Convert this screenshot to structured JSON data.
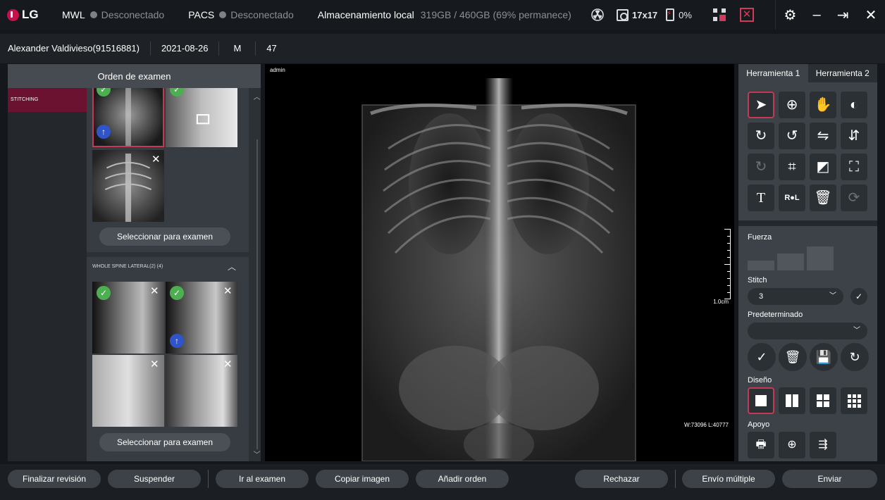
{
  "topbar": {
    "logo_text": "LG",
    "mwl": {
      "label": "MWL",
      "state": "Desconectado"
    },
    "pacs": {
      "label": "PACS",
      "state": "Desconectado"
    },
    "storage": {
      "label": "Almacenamiento local",
      "value": "319GB / 460GB (69% permanece)"
    },
    "detector_size": "17x17",
    "battery": "0%",
    "icons": [
      "radiation-icon",
      "detector-icon",
      "battery-icon",
      "qr-icon",
      "close-box-icon",
      "gear-icon",
      "minimize-icon",
      "logout-icon",
      "close-icon"
    ]
  },
  "patient": {
    "name": "Alexander Valdivieso(91516881)",
    "date": "2021-08-26",
    "sex": "M",
    "age": "47"
  },
  "left_panel": {
    "title": "Orden de examen",
    "orders": [
      {
        "label": "STITCHING"
      }
    ],
    "group2_title": "WHOLE SPINE LATERAL(2) (4)",
    "select_button": "Seleccionar para examen",
    "colors": {
      "selected": "#c43a55",
      "ok": "#4caf50",
      "upload": "#2f55c8"
    }
  },
  "viewer": {
    "user_label": "admin",
    "scale_label": "1.0cm",
    "window_level": "W:73096 L:40777"
  },
  "right_panel": {
    "tabs": [
      "Herramienta 1",
      "Herramienta 2"
    ],
    "tools": [
      {
        "name": "pointer-icon",
        "glyph": "➤"
      },
      {
        "name": "zoom-icon",
        "glyph": "⊕"
      },
      {
        "name": "pan-hand-icon",
        "glyph": "✋"
      },
      {
        "name": "window-level-icon",
        "glyph": "◐"
      },
      {
        "name": "rotate-cw-icon",
        "glyph": "↻"
      },
      {
        "name": "rotate-ccw-icon",
        "glyph": "↺"
      },
      {
        "name": "flip-horizontal-icon",
        "glyph": "⇋"
      },
      {
        "name": "flip-vertical-icon",
        "glyph": "⇵"
      },
      {
        "name": "rotate-360-icon",
        "glyph": "↻"
      },
      {
        "name": "crop-icon",
        "glyph": "⌗"
      },
      {
        "name": "invert-icon",
        "glyph": "◩"
      },
      {
        "name": "fit-screen-icon",
        "glyph": "⛶"
      },
      {
        "name": "text-icon",
        "glyph": "T"
      },
      {
        "name": "marker-rl-icon",
        "glyph": "R●L"
      },
      {
        "name": "trash-icon",
        "glyph": "🗑"
      },
      {
        "name": "reset-icon",
        "glyph": "⟳"
      }
    ],
    "fuerza_label": "Fuerza",
    "stitch_label": "Stitch",
    "stitch_value": "3",
    "preset_label": "Predeterminado",
    "preset_value": "",
    "design_label": "Diseño",
    "support_label": "Apoyo"
  },
  "bottom": {
    "finalize": "Finalizar revisión",
    "suspend": "Suspender",
    "go_exam": "Ir al examen",
    "copy_image": "Copiar imagen",
    "add_order": "Añadir orden",
    "reject": "Rechazar",
    "multi_send": "Envío múltiple",
    "send": "Enviar"
  }
}
